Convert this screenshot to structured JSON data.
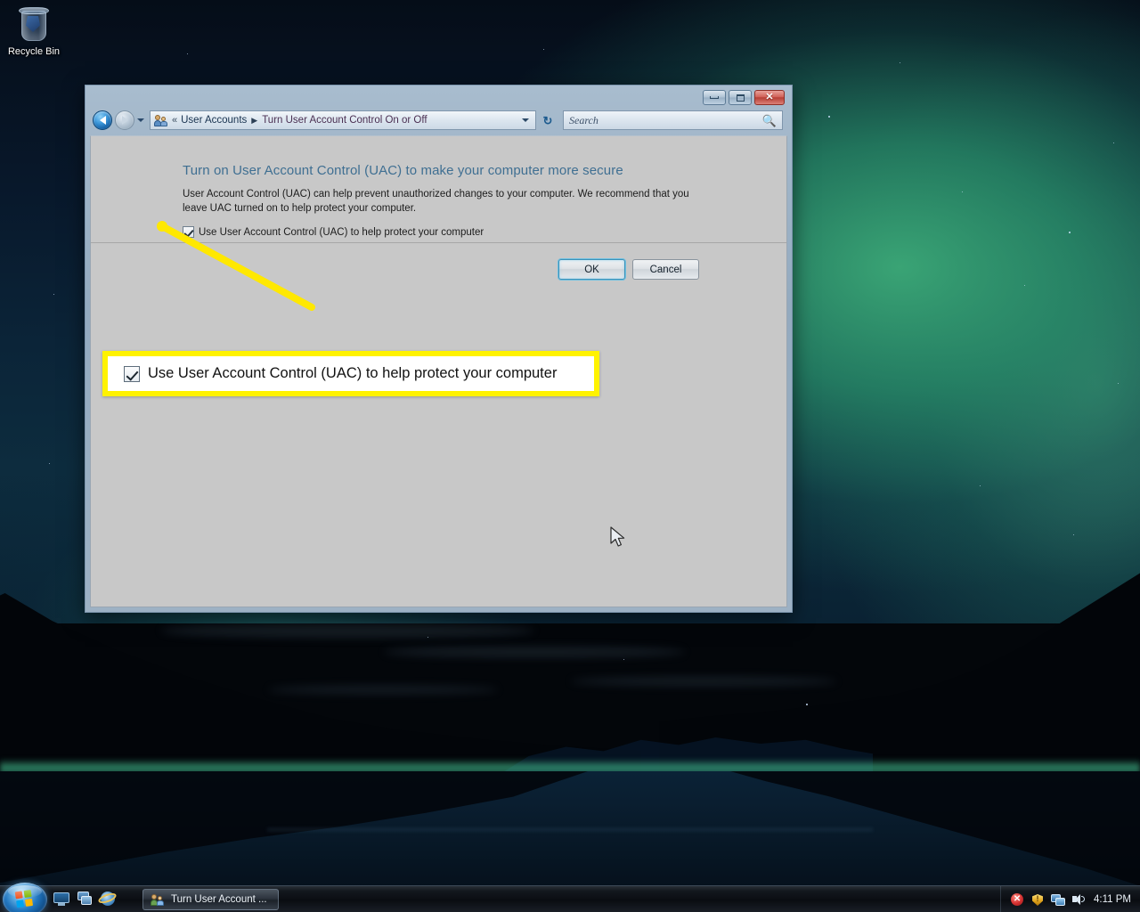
{
  "desktop": {
    "recycle_bin": {
      "label": "Recycle Bin",
      "icon": "recycle-bin-icon"
    }
  },
  "window": {
    "controls": {
      "minimize": "Minimize",
      "maximize": "Maximize",
      "close": "Close",
      "close_glyph": "✕"
    },
    "nav": {
      "back_tooltip": "Back",
      "forward_tooltip": "Forward",
      "history_tooltip": "Recent Pages",
      "refresh_glyph": "↻",
      "address_icon": "user-accounts-icon",
      "overflow_chevron": "«",
      "breadcrumbs": [
        {
          "label": "User Accounts"
        },
        {
          "label": "Turn User Account Control On or Off"
        }
      ],
      "breadcrumb_separator": "▶"
    },
    "search": {
      "placeholder": "Search",
      "value": "",
      "icon": "search-icon"
    },
    "content": {
      "heading": "Turn on User Account Control (UAC) to make your computer more secure",
      "description": "User Account Control (UAC) can help prevent unauthorized changes to your computer.  We recommend that you leave UAC turned on to help protect your computer.",
      "checkbox_label": "Use User Account Control (UAC) to help protect your computer",
      "checkbox_checked": true
    },
    "buttons": {
      "ok": "OK",
      "cancel": "Cancel"
    }
  },
  "annotation": {
    "callout_text": "Use User Account Control (UAC) to help protect your computer",
    "callout_checked": true,
    "highlight_color": "#fff200",
    "line_color": "#ffe800"
  },
  "taskbar": {
    "start_tooltip": "Start",
    "quicklaunch": [
      {
        "name": "show-desktop-icon"
      },
      {
        "name": "switch-between-windows-icon"
      },
      {
        "name": "internet-explorer-icon"
      }
    ],
    "tasks": [
      {
        "label": "Turn User Account ...",
        "icon": "user-accounts-icon"
      }
    ],
    "tray": [
      {
        "name": "security-alert-icon"
      },
      {
        "name": "warning-shield-icon"
      },
      {
        "name": "network-icon"
      },
      {
        "name": "volume-icon"
      }
    ],
    "clock": "4:11 PM"
  }
}
